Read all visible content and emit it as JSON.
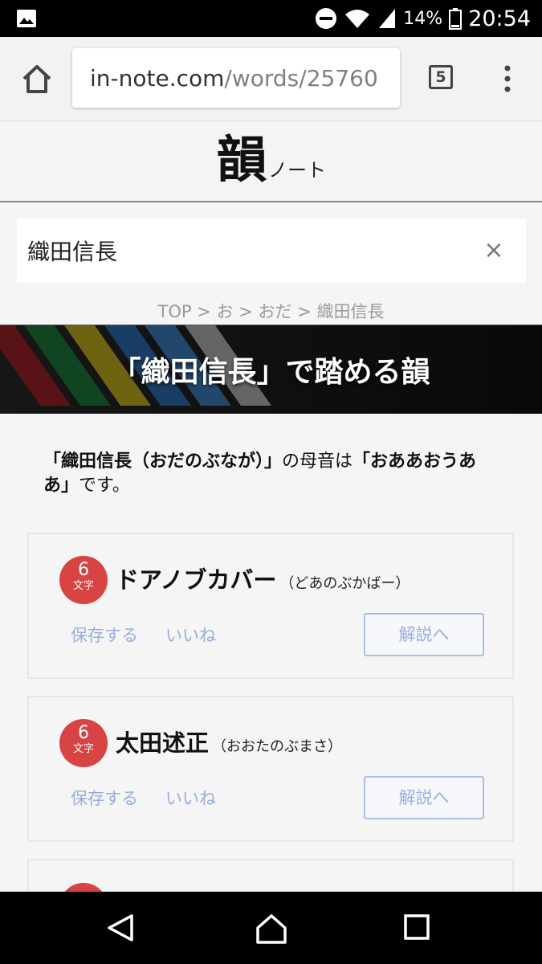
{
  "status_bar": {
    "battery_percent": "14%",
    "time": "20:54",
    "icons": [
      "image-notification-icon",
      "do-not-disturb-icon",
      "wifi-icon",
      "signal-icon",
      "battery-icon"
    ]
  },
  "browser": {
    "url_domain": "in-note.com",
    "url_path": "/words/25760",
    "tab_count": "5",
    "icons": [
      "home-icon",
      "tabs-icon",
      "overflow-menu-icon"
    ]
  },
  "site": {
    "logo_main": "韻",
    "logo_sub": "ノート"
  },
  "search": {
    "value": "織田信長",
    "clear_label": "×"
  },
  "breadcrumb": {
    "items": [
      "TOP",
      "お",
      "おだ",
      "織田信長"
    ],
    "separator": ">"
  },
  "banner": {
    "title": "「織田信長」で踏める韻"
  },
  "description": {
    "part1": "「織田信長（おだのぶなが）」",
    "part2": "の母音は",
    "part3": "「おああおうああ」",
    "part4": "です。"
  },
  "results": [
    {
      "char_count": "6",
      "char_unit": "文字",
      "word": "ドアノブカバー",
      "reading": "（どあのぶかばー）",
      "save_label": "保存する",
      "like_label": "いいね",
      "explain_label": "解説へ"
    },
    {
      "char_count": "6",
      "char_unit": "文字",
      "word": "太田述正",
      "reading": "（おおたのぶまさ）",
      "save_label": "保存する",
      "like_label": "いいね",
      "explain_label": "解説へ"
    }
  ],
  "nav_bar": {
    "icons": [
      "back-icon",
      "home-nav-icon",
      "recents-icon"
    ]
  },
  "colors": {
    "badge": "#d84444",
    "link": "#98aede",
    "status_bar": "#000000"
  }
}
